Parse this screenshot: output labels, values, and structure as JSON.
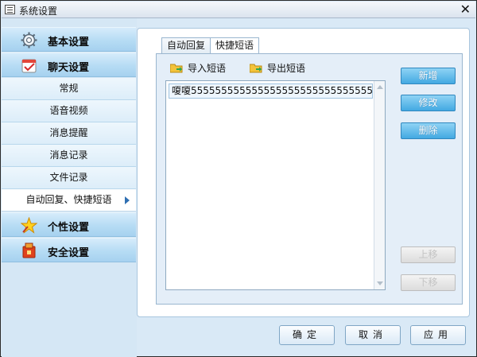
{
  "window": {
    "title": "系统设置",
    "close_symbol": "✕"
  },
  "sidebar": {
    "categories": [
      {
        "label": "基本设置",
        "icon": "gear-icon"
      },
      {
        "label": "聊天设置",
        "icon": "chat-settings-icon"
      },
      {
        "label": "个性设置",
        "icon": "star-icon"
      },
      {
        "label": "安全设置",
        "icon": "security-icon"
      }
    ],
    "chat_items": [
      {
        "label": "常规"
      },
      {
        "label": "语音视频"
      },
      {
        "label": "消息提醒"
      },
      {
        "label": "消息记录"
      },
      {
        "label": "文件记录"
      },
      {
        "label": "自动回复、快捷短语"
      }
    ],
    "active_item": "自动回复、快捷短语"
  },
  "tabs": [
    {
      "label": "自动回复"
    },
    {
      "label": "快捷短语"
    }
  ],
  "active_tab": "快捷短语",
  "toolbar": {
    "import_label": "导入短语",
    "export_label": "导出短语"
  },
  "phrases": [
    "嗄嗄555555555555555555555555555555555555555..."
  ],
  "side_buttons": {
    "add": "新增",
    "edit": "修改",
    "delete": "删除",
    "move_up": "上移",
    "move_down": "下移"
  },
  "footer": {
    "ok": "确定",
    "cancel": "取消",
    "apply": "应用"
  },
  "colors": {
    "accent_button": "#43a9e2",
    "sidebar_category": "#b6dcf4",
    "panel_bg": "#d9e9f6"
  }
}
